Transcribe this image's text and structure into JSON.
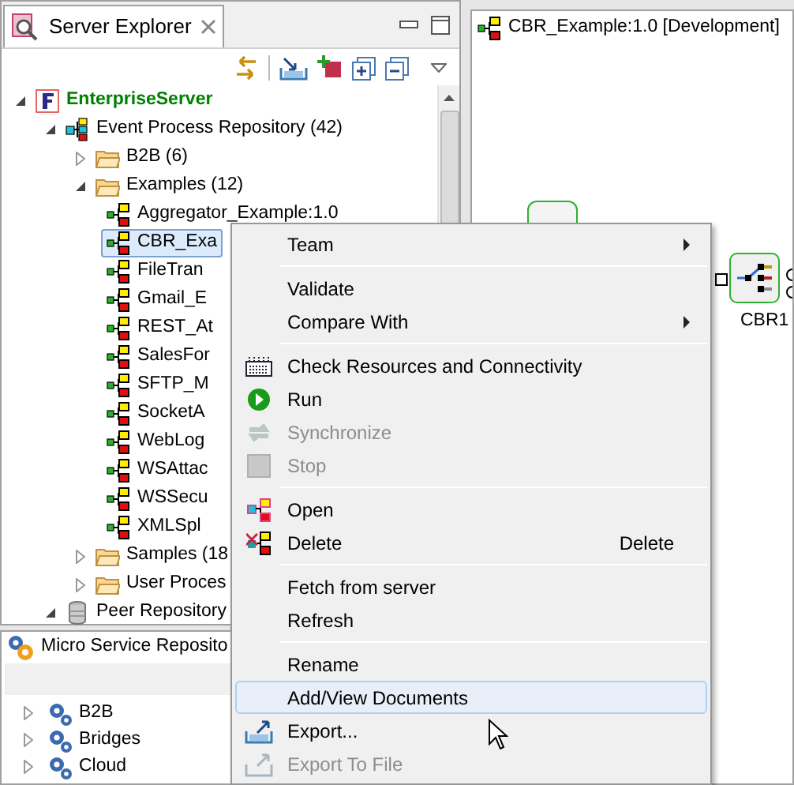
{
  "explorer": {
    "tab_title": "Server Explorer",
    "tree": [
      {
        "label": "EnterpriseServer",
        "kind": "server",
        "expanded": true,
        "selected": false,
        "children": [
          {
            "label": "Event Process Repository (42)",
            "kind": "repository",
            "expanded": true,
            "selected": false,
            "children": [
              {
                "label": "B2B (6)",
                "kind": "folder",
                "expanded": false,
                "selected": false
              },
              {
                "label": "Examples (12)",
                "kind": "folder",
                "expanded": true,
                "selected": false,
                "children": [
                  {
                    "label": "Aggregator_Example:1.0",
                    "kind": "process",
                    "selected": false
                  },
                  {
                    "label": "CBR_Exa",
                    "kind": "process",
                    "selected": true
                  },
                  {
                    "label": "FileTran",
                    "kind": "process",
                    "selected": false
                  },
                  {
                    "label": "Gmail_E",
                    "kind": "process",
                    "selected": false
                  },
                  {
                    "label": "REST_At",
                    "kind": "process",
                    "selected": false
                  },
                  {
                    "label": "SalesFor",
                    "kind": "process",
                    "selected": false
                  },
                  {
                    "label": "SFTP_M",
                    "kind": "process",
                    "selected": false
                  },
                  {
                    "label": "SocketA",
                    "kind": "process",
                    "selected": false
                  },
                  {
                    "label": "WebLog",
                    "kind": "process",
                    "selected": false
                  },
                  {
                    "label": "WSAttac",
                    "kind": "process",
                    "selected": false
                  },
                  {
                    "label": "WSSecu",
                    "kind": "process",
                    "selected": false
                  },
                  {
                    "label": "XMLSpl",
                    "kind": "process",
                    "selected": false
                  }
                ]
              },
              {
                "label": "Samples (18",
                "kind": "folder",
                "expanded": false,
                "selected": false
              },
              {
                "label": "User Proces",
                "kind": "folder",
                "expanded": false,
                "selected": false
              }
            ]
          },
          {
            "label": "Peer Repository",
            "kind": "database",
            "expanded": true,
            "selected": false
          }
        ]
      }
    ]
  },
  "micro_service": {
    "title": "Micro Service Reposito",
    "tree": [
      {
        "label": "B2B",
        "expanded": false,
        "selected": false
      },
      {
        "label": "Bridges",
        "expanded": false,
        "selected": false
      },
      {
        "label": "Cloud",
        "expanded": false,
        "selected": false
      }
    ]
  },
  "editor": {
    "tab_title": "CBR_Example:1.0 [Development]",
    "nodes": [
      {
        "label": "CBR1"
      }
    ]
  },
  "context_menu": {
    "items": [
      {
        "kind": "item",
        "label": "Team",
        "submenu": true,
        "disabled": false,
        "highlighted": false
      },
      {
        "kind": "separator"
      },
      {
        "kind": "item",
        "label": "Validate",
        "submenu": false,
        "disabled": false,
        "highlighted": false
      },
      {
        "kind": "item",
        "label": "Compare With",
        "submenu": true,
        "disabled": false,
        "highlighted": false
      },
      {
        "kind": "separator"
      },
      {
        "kind": "item",
        "label": "Check Resources and Connectivity",
        "submenu": false,
        "disabled": false,
        "highlighted": false
      },
      {
        "kind": "item",
        "label": "Run",
        "submenu": false,
        "disabled": false,
        "highlighted": false
      },
      {
        "kind": "item",
        "label": "Synchronize",
        "submenu": false,
        "disabled": true,
        "highlighted": false
      },
      {
        "kind": "item",
        "label": "Stop",
        "submenu": false,
        "disabled": true,
        "highlighted": false
      },
      {
        "kind": "separator"
      },
      {
        "kind": "item",
        "label": "Open",
        "submenu": false,
        "disabled": false,
        "highlighted": false
      },
      {
        "kind": "item",
        "label": "Delete",
        "shortcut": "Delete",
        "submenu": false,
        "disabled": false,
        "highlighted": false
      },
      {
        "kind": "separator"
      },
      {
        "kind": "item",
        "label": "Fetch from server",
        "submenu": false,
        "disabled": false,
        "highlighted": false
      },
      {
        "kind": "item",
        "label": "Refresh",
        "submenu": false,
        "disabled": false,
        "highlighted": false
      },
      {
        "kind": "separator"
      },
      {
        "kind": "item",
        "label": "Rename",
        "submenu": false,
        "disabled": false,
        "highlighted": false
      },
      {
        "kind": "item",
        "label": "Add/View Documents",
        "submenu": false,
        "disabled": false,
        "highlighted": true
      },
      {
        "kind": "item",
        "label": "Export...",
        "submenu": false,
        "disabled": false,
        "highlighted": false
      },
      {
        "kind": "item",
        "label": "Export To File",
        "submenu": false,
        "disabled": true,
        "highlighted": false
      }
    ]
  }
}
